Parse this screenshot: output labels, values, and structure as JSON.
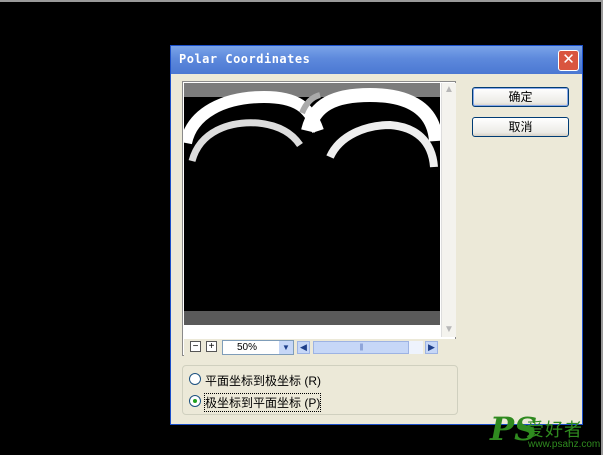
{
  "dialog": {
    "title": "Polar Coordinates",
    "close_glyph": "✕",
    "ok_label": "确定",
    "cancel_label": "取消"
  },
  "preview": {
    "zoom_out_glyph": "−",
    "zoom_in_glyph": "+",
    "zoom_value": "50%",
    "scroll_up_glyph": "▲",
    "scroll_down_glyph": "▼",
    "scroll_left_glyph": "◀",
    "scroll_right_glyph": "▶",
    "dropdown_glyph": "▼",
    "thumb_grip": "|||"
  },
  "options": [
    {
      "label": "平面坐标到极坐标 (R)",
      "selected": false
    },
    {
      "label": "极坐标到平面坐标 (P)",
      "selected": true
    }
  ],
  "watermark": {
    "logo": "PS",
    "text": "爱好者",
    "url": "www.psahz.com"
  },
  "colors": {
    "titlebar": "#5d89dc",
    "dialog_bg": "#ece9d8",
    "accent": "#2f8a1f"
  }
}
